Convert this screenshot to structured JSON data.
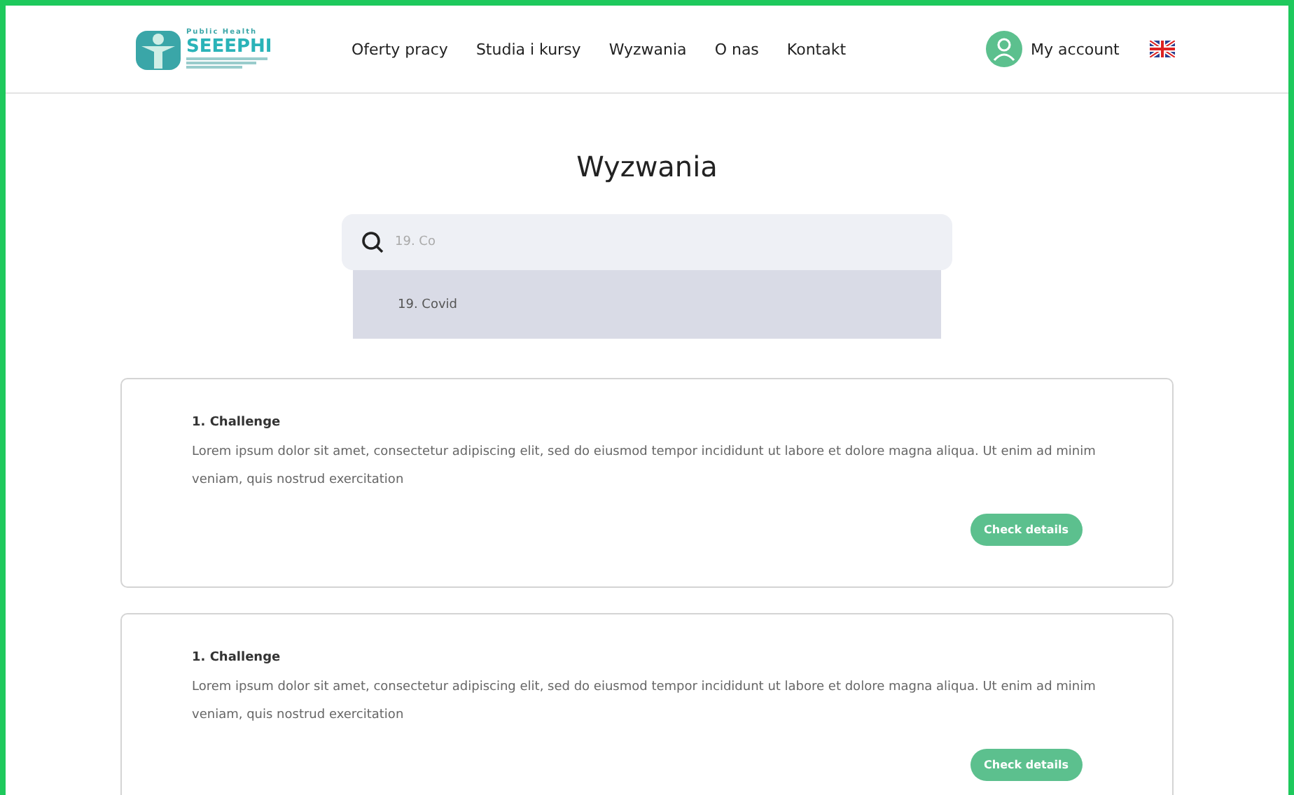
{
  "header": {
    "logo": {
      "small": "Public Health",
      "name": "SEEEPHI"
    },
    "nav": [
      {
        "label": "Oferty pracy",
        "selected": false
      },
      {
        "label": "Studia i kursy",
        "selected": false
      },
      {
        "label": "Wyzwania",
        "selected": false
      },
      {
        "label": "O nas",
        "selected": false
      },
      {
        "label": "Kontakt",
        "selected": false
      }
    ],
    "account": "My account"
  },
  "title": "Wyzwania",
  "search": {
    "value": "19. Co",
    "suggestions": [
      "19. Covid"
    ]
  },
  "cards": [
    {
      "title": "1. Challenge",
      "text": "Lorem ipsum dolor sit amet, consectetur adipiscing elit, sed do eiusmod tempor incididunt ut labore et dolore magna aliqua. Ut enim ad minim veniam, quis nostrud exercitation",
      "button": "Check details"
    },
    {
      "title": "1. Challenge",
      "text": "Lorem ipsum dolor sit amet, consectetur adipiscing elit, sed do eiusmod tempor incididunt ut labore et dolore magna aliqua. Ut enim ad minim veniam, quis nostrud exercitation",
      "button": "Check details"
    }
  ]
}
